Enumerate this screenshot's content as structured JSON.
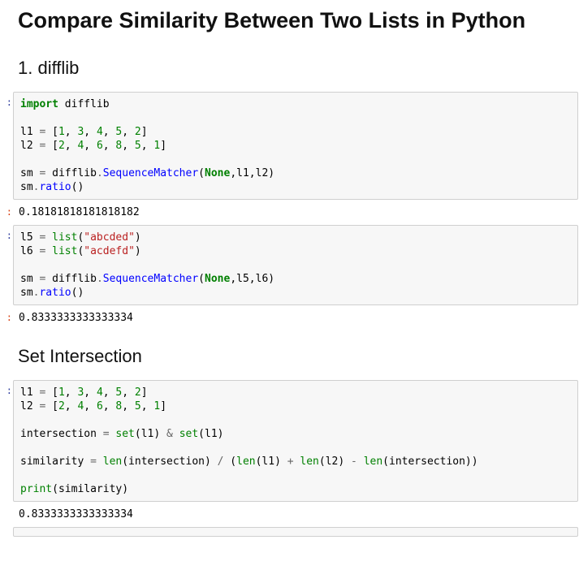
{
  "title": "Compare Similarity Between Two Lists in Python",
  "section1": "1. difflib",
  "section2": "Set Intersection",
  "cell1": {
    "import": "import",
    "difflib": " difflib",
    "l1_name": "l1 ",
    "eq": "=",
    "l1_open": " [",
    "l1_vals": [
      "1",
      "3",
      "4",
      "5",
      "2"
    ],
    "l1_close": "]",
    "l2_name": "l2 ",
    "l2_open": " [",
    "l2_vals": [
      "2",
      "4",
      "6",
      "8",
      "5",
      "1"
    ],
    "l2_close": "]",
    "sm_name": "sm ",
    "difflib_mod": " difflib",
    "dot": ".",
    "SequenceMatcher": "SequenceMatcher",
    "lparen": "(",
    "None": "None",
    "args1": ",l1,l2)",
    "sm_call": "sm",
    "ratio": "ratio",
    "parens": "()"
  },
  "out1": "0.18181818181818182",
  "cell2": {
    "l5_name": "l5 ",
    "list": "list",
    "str1": "\"abcded\"",
    "l6_name": "l6 ",
    "str2": "\"acdefd\"",
    "args2": ",l5,l6)"
  },
  "out2": "0.8333333333333334",
  "cell3": {
    "intersection_name": "intersection ",
    "set": "set",
    "l1arg": "(l1) ",
    "amp": "&",
    "l1arg2": "(l1)",
    "similarity_name": "similarity ",
    "len": "len",
    "int_arg": "(intersection) ",
    "slash": "/",
    "sp_lparen": " (",
    "l1_arg": "(l1) ",
    "plus": "+",
    "l2_arg": "(l2) ",
    "minus": "-",
    "int_close": "(intersection))",
    "print": "print",
    "sim_arg": "(similarity)"
  },
  "out3": "0.8333333333333334",
  "comma": ", ",
  "sp": " ",
  "rparen": ")"
}
